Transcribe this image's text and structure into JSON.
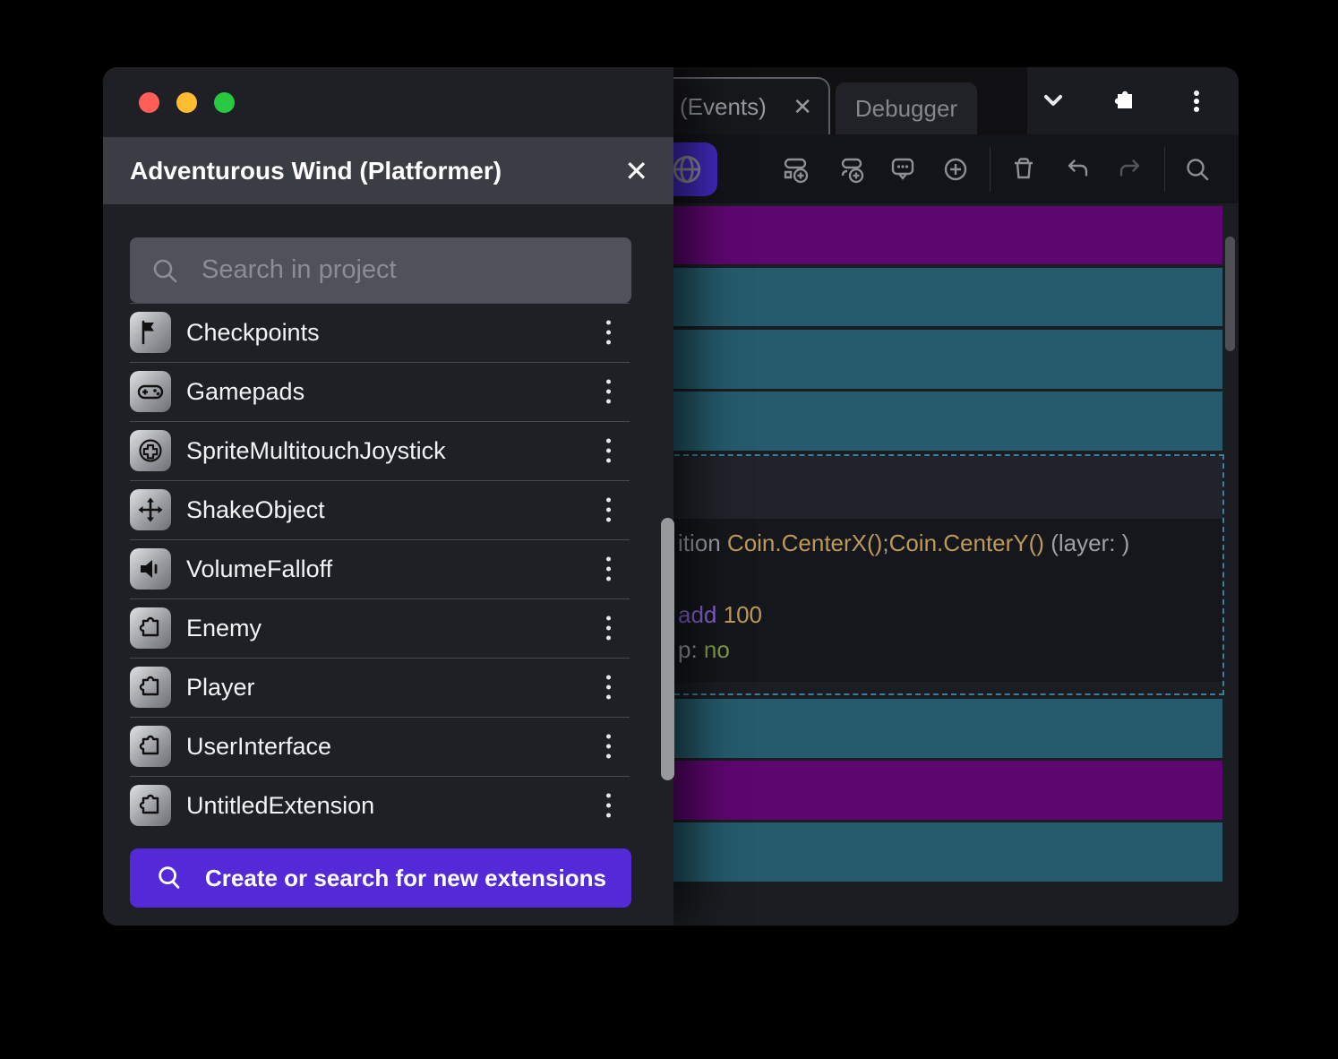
{
  "palette": {
    "accent": "#5429d8",
    "toolbar_accent": "#4229bd",
    "row_purple": "#5e0670",
    "row_teal": "#255b6c",
    "code_gold": "#bd9a58",
    "code_purple": "#8a63d8",
    "code_green": "#7f9d45",
    "selection_dash": "#3f7d9c"
  },
  "titlebar": {
    "traffic_lights": [
      "close",
      "minimize",
      "zoom"
    ],
    "icons": [
      "chevron-down",
      "extensions-puzzle",
      "kebab-menu"
    ]
  },
  "tabs": [
    {
      "label": "(Events)",
      "active": true,
      "close_icon": "✕"
    },
    {
      "label": "Debugger",
      "active": false
    }
  ],
  "toolbar": {
    "icons": [
      "scene-globe",
      "add-event",
      "add-subevent",
      "add-comment",
      "add-circle",
      "delete-trash",
      "undo",
      "redo",
      "search"
    ]
  },
  "events_sheet": {
    "rows": [
      {
        "kind": "purple"
      },
      {
        "kind": "teal"
      },
      {
        "kind": "teal"
      },
      {
        "kind": "teal"
      },
      {
        "kind": "selected"
      },
      {
        "kind": "teal"
      },
      {
        "kind": "purple"
      },
      {
        "kind": "teal"
      }
    ],
    "selected_event": {
      "line1": [
        {
          "t": "ition "
        },
        {
          "t": "Coin.CenterX()"
        },
        {
          "t": ";"
        },
        {
          "t": "Coin.CenterY()"
        },
        {
          "t": " (layer: )"
        }
      ],
      "line2": [
        {
          "t": "add "
        },
        {
          "t": "100"
        }
      ],
      "line3": [
        {
          "t": "p: "
        },
        {
          "t": "no"
        }
      ]
    }
  },
  "modal": {
    "title": "Adventurous Wind (Platformer)",
    "close_icon": "✕",
    "search": {
      "placeholder": "Search in project",
      "value": ""
    },
    "items": [
      {
        "label": "Checkpoints",
        "icon": "flag-icon"
      },
      {
        "label": "Gamepads",
        "icon": "gamepad-icon"
      },
      {
        "label": "SpriteMultitouchJoystick",
        "icon": "joystick-icon"
      },
      {
        "label": "ShakeObject",
        "icon": "move-arrows-icon"
      },
      {
        "label": "VolumeFalloff",
        "icon": "speaker-icon"
      },
      {
        "label": "Enemy",
        "icon": "puzzle-icon"
      },
      {
        "label": "Player",
        "icon": "puzzle-icon"
      },
      {
        "label": "UserInterface",
        "icon": "puzzle-icon"
      },
      {
        "label": "UntitledExtension",
        "icon": "puzzle-icon"
      }
    ],
    "create_button_label": "Create or search for new extensions"
  }
}
